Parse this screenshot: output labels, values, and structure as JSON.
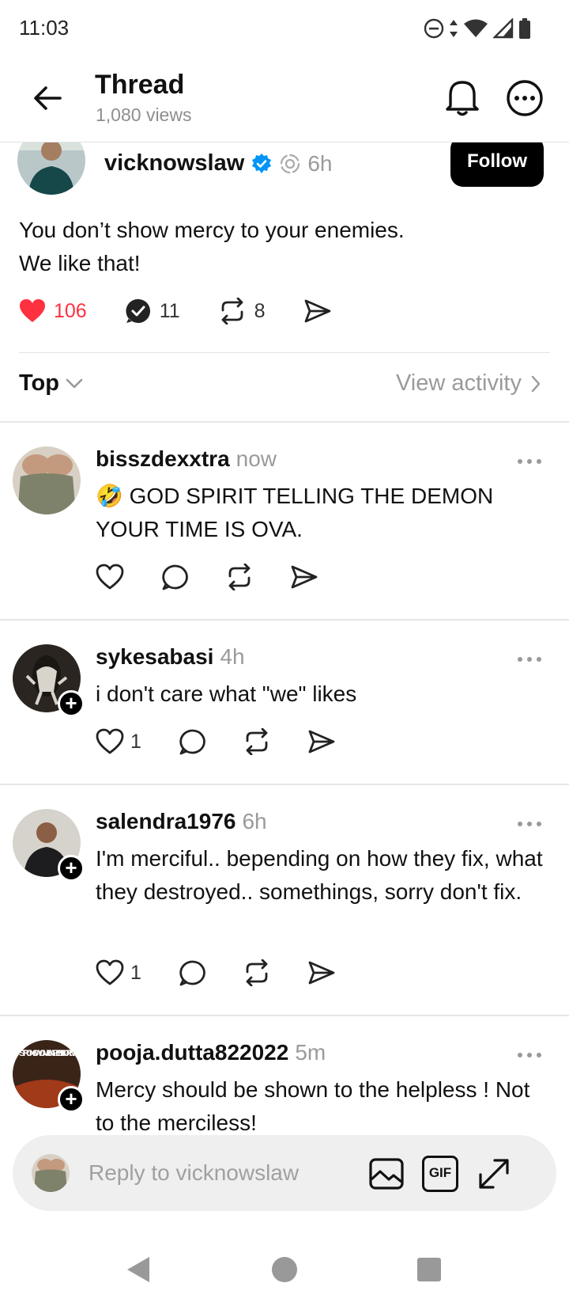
{
  "status_bar": {
    "time": "11:03",
    "icons": [
      "do-not-disturb-icon",
      "data-arrows-icon",
      "wifi-icon",
      "signal-icon",
      "battery-icon"
    ]
  },
  "header": {
    "title": "Thread",
    "views": "1,080 views",
    "icons": [
      "back-arrow-icon",
      "bell-icon",
      "more-icon"
    ]
  },
  "post": {
    "username": "vicknowslaw",
    "verified": true,
    "time": "6h",
    "follow_label": "Follow",
    "text_line1": "You don’t show mercy to your enemies.",
    "text_line2": "We like that!",
    "likes": "106",
    "replies": "11",
    "reposts": "8",
    "liked": true,
    "accent_like": "#ff3040"
  },
  "sort": {
    "label": "Top",
    "activity": "View activity"
  },
  "replies": [
    {
      "username": "bisszdexxtra",
      "time": "now",
      "emoji": "🤣",
      "text": " GOD SPIRIT TELLING THE DEMON YOUR TIME IS OVA.",
      "likes": ""
    },
    {
      "username": "sykesabasi",
      "time": "4h",
      "text": "i don't care what \"we\" likes",
      "likes": "1"
    },
    {
      "username": "salendra1976",
      "time": "6h",
      "text": "I'm merciful.. bepending on how they fix, what they destroyed.. somethings, sorry don't fix.",
      "likes": "1"
    },
    {
      "username": "pooja.dutta822022",
      "time": "5m",
      "text": "Mercy should be shown to the helpless ! Not to the merciless!",
      "avatar_text": "STRONG WOMEN AREN'T BORN."
    }
  ],
  "composer": {
    "placeholder": "Reply to vicknowslaw",
    "gif_label": "GIF"
  },
  "navbar": {
    "icons": [
      "back-triangle-icon",
      "home-circle-icon",
      "recents-square-icon"
    ]
  }
}
